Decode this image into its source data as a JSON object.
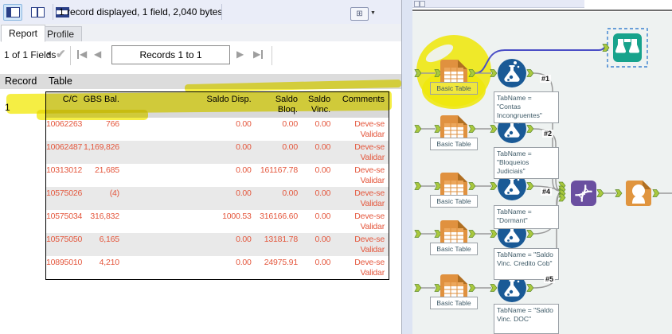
{
  "window": {
    "status_text": "1 record displayed, 1 field, 2,040 bytes"
  },
  "tabs": {
    "report": "Report",
    "profile": "Profile"
  },
  "nav": {
    "fields": "1 of 1 Fields",
    "records": "Records 1 to 1"
  },
  "grid": {
    "record_col": "Record",
    "table_col": "Table",
    "record_num": "1"
  },
  "report_table": {
    "columns": [
      "C/C",
      "GBS Bal.",
      "Saldo Disp.",
      "Saldo Bloq.",
      "Saldo Vinc.",
      "Comments"
    ],
    "rows": [
      [
        "10062263",
        "766",
        "0.00",
        "0.00",
        "0.00",
        "Deve-se Validar"
      ],
      [
        "10062487",
        "1,169,826",
        "0.00",
        "0.00",
        "0.00",
        "Deve-se Validar"
      ],
      [
        "10313012",
        "21,685",
        "0.00",
        "161167.78",
        "0.00",
        "Deve-se Validar"
      ],
      [
        "10575026",
        "(4)",
        "0.00",
        "0.00",
        "0.00",
        "Deve-se Validar"
      ],
      [
        "10575034",
        "316,832",
        "1000.53",
        "316166.60",
        "0.00",
        "Deve-se Validar"
      ],
      [
        "10575050",
        "6,165",
        "0.00",
        "13181.78",
        "0.00",
        "Deve-se Validar"
      ],
      [
        "10895010",
        "4,210",
        "0.00",
        "24975.91",
        "0.00",
        "Deve-se Validar"
      ]
    ]
  },
  "canvas": {
    "basic_table_labels": [
      "Basic Table",
      "Basic Table",
      "Basic Table",
      "Basic Table",
      "Basic Table"
    ],
    "annotations": [
      "TabName = \"Contas Incongruentes\"",
      "TabName = \"Bloqueios Judiciais\"",
      "TabName = \"Dormant\"",
      "TabName = \"Saldo Vinc. Credito Cob\"",
      "TabName = \"Saldo Vinc. DOC\""
    ],
    "connection_labels": [
      "#1",
      "#2",
      "#4",
      "#5"
    ]
  },
  "colors": {
    "highlighter": "#f2e90f",
    "report_text_red": "#e4573d",
    "tool_orange": "#e0913f",
    "tool_blue": "#1a5a96",
    "tool_teal": "#17a38c",
    "tool_purple": "#6a4fa0",
    "anchor_green": "#a9c83e",
    "wire_blue": "#4a4ec6"
  }
}
